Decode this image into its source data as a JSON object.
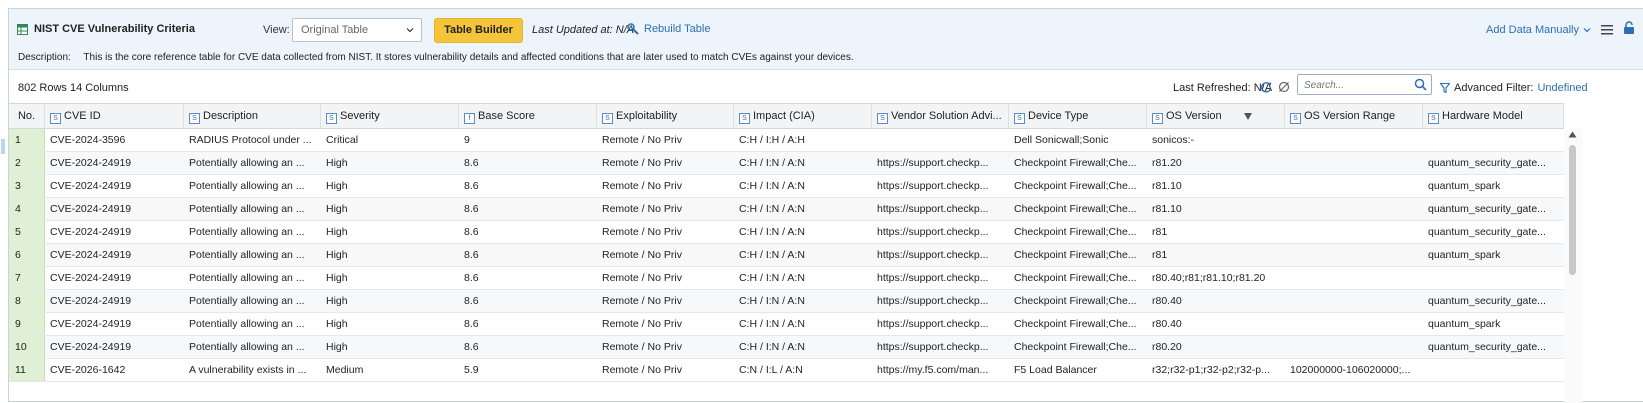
{
  "header": {
    "title": "NIST CVE Vulnerability Criteria",
    "view_label": "View:",
    "view_selected": "Original Table",
    "table_builder_label": "Table Builder",
    "last_updated": "Last Updated at: N/A",
    "rebuild_label": "Rebuild Table",
    "add_data_label": "Add Data Manually",
    "description_label": "Description:",
    "description_text": "This is the core reference table for CVE data collected from NIST. It stores vulnerability details and affected conditions that are later used to match CVEs against your devices."
  },
  "toolbar": {
    "row_count": "802 Rows  14 Columns",
    "last_refreshed": "Last Refreshed: N/A",
    "search_placeholder": "Search...",
    "advanced_filter_label": "Advanced Filter:",
    "advanced_filter_value": "Undefined"
  },
  "colors": {
    "accent": "#2c6fb5",
    "table_builder": "#f4c43a",
    "row_number_bg": "#dff0d4",
    "header_bg": "#eef4fb"
  },
  "columns": [
    {
      "label": "No.",
      "tag": ""
    },
    {
      "label": "CVE ID",
      "tag": "S"
    },
    {
      "label": "Description",
      "tag": "S"
    },
    {
      "label": "Severity",
      "tag": "S"
    },
    {
      "label": "Base Score",
      "tag": "f"
    },
    {
      "label": "Exploitability",
      "tag": "S"
    },
    {
      "label": "Impact (CIA)",
      "tag": "S"
    },
    {
      "label": "Vendor Solution Advi...",
      "tag": "S"
    },
    {
      "label": "Device Type",
      "tag": "S"
    },
    {
      "label": "OS Version",
      "tag": "S"
    },
    {
      "label": "OS Version Range",
      "tag": "S"
    },
    {
      "label": "Hardware Model",
      "tag": "S"
    }
  ],
  "rows": [
    [
      "1",
      "CVE-2024-3596",
      "RADIUS Protocol under ...",
      "Critical",
      "9",
      "Remote / No Priv",
      "C:H / I:H / A:H",
      "",
      "Dell Sonicwall;Sonic",
      "sonicos:-",
      "",
      ""
    ],
    [
      "2",
      "CVE-2024-24919",
      "Potentially allowing an ...",
      "High",
      "8.6",
      "Remote / No Priv",
      "C:H / I:N / A:N",
      "https://support.checkp...",
      "Checkpoint Firewall;Che...",
      "r81.20",
      "",
      "quantum_security_gate..."
    ],
    [
      "3",
      "CVE-2024-24919",
      "Potentially allowing an ...",
      "High",
      "8.6",
      "Remote / No Priv",
      "C:H / I:N / A:N",
      "https://support.checkp...",
      "Checkpoint Firewall;Che...",
      "r81.10",
      "",
      "quantum_spark"
    ],
    [
      "4",
      "CVE-2024-24919",
      "Potentially allowing an ...",
      "High",
      "8.6",
      "Remote / No Priv",
      "C:H / I:N / A:N",
      "https://support.checkp...",
      "Checkpoint Firewall;Che...",
      "r81.10",
      "",
      "quantum_security_gate..."
    ],
    [
      "5",
      "CVE-2024-24919",
      "Potentially allowing an ...",
      "High",
      "8.6",
      "Remote / No Priv",
      "C:H / I:N / A:N",
      "https://support.checkp...",
      "Checkpoint Firewall;Che...",
      "r81",
      "",
      "quantum_security_gate..."
    ],
    [
      "6",
      "CVE-2024-24919",
      "Potentially allowing an ...",
      "High",
      "8.6",
      "Remote / No Priv",
      "C:H / I:N / A:N",
      "https://support.checkp...",
      "Checkpoint Firewall;Che...",
      "r81",
      "",
      "quantum_spark"
    ],
    [
      "7",
      "CVE-2024-24919",
      "Potentially allowing an ...",
      "High",
      "8.6",
      "Remote / No Priv",
      "C:H / I:N / A:N",
      "https://support.checkp...",
      "Checkpoint Firewall;Che...",
      "r80.40;r81;r81.10;r81.20",
      "",
      ""
    ],
    [
      "8",
      "CVE-2024-24919",
      "Potentially allowing an ...",
      "High",
      "8.6",
      "Remote / No Priv",
      "C:H / I:N / A:N",
      "https://support.checkp...",
      "Checkpoint Firewall;Che...",
      "r80.40",
      "",
      "quantum_security_gate..."
    ],
    [
      "9",
      "CVE-2024-24919",
      "Potentially allowing an ...",
      "High",
      "8.6",
      "Remote / No Priv",
      "C:H / I:N / A:N",
      "https://support.checkp...",
      "Checkpoint Firewall;Che...",
      "r80.40",
      "",
      "quantum_spark"
    ],
    [
      "10",
      "CVE-2024-24919",
      "Potentially allowing an ...",
      "High",
      "8.6",
      "Remote / No Priv",
      "C:H / I:N / A:N",
      "https://support.checkp...",
      "Checkpoint Firewall;Che...",
      "r80.20",
      "",
      "quantum_security_gate..."
    ],
    [
      "11",
      "CVE-2026-1642",
      "A vulnerability exists in ...",
      "Medium",
      "5.9",
      "Remote / No Priv",
      "C:N / I:L / A:N",
      "https://my.f5.com/man...",
      "F5 Load Balancer",
      "r32;r32-p1;r32-p2;r32-p...",
      "102000000-106020000;...",
      ""
    ]
  ]
}
